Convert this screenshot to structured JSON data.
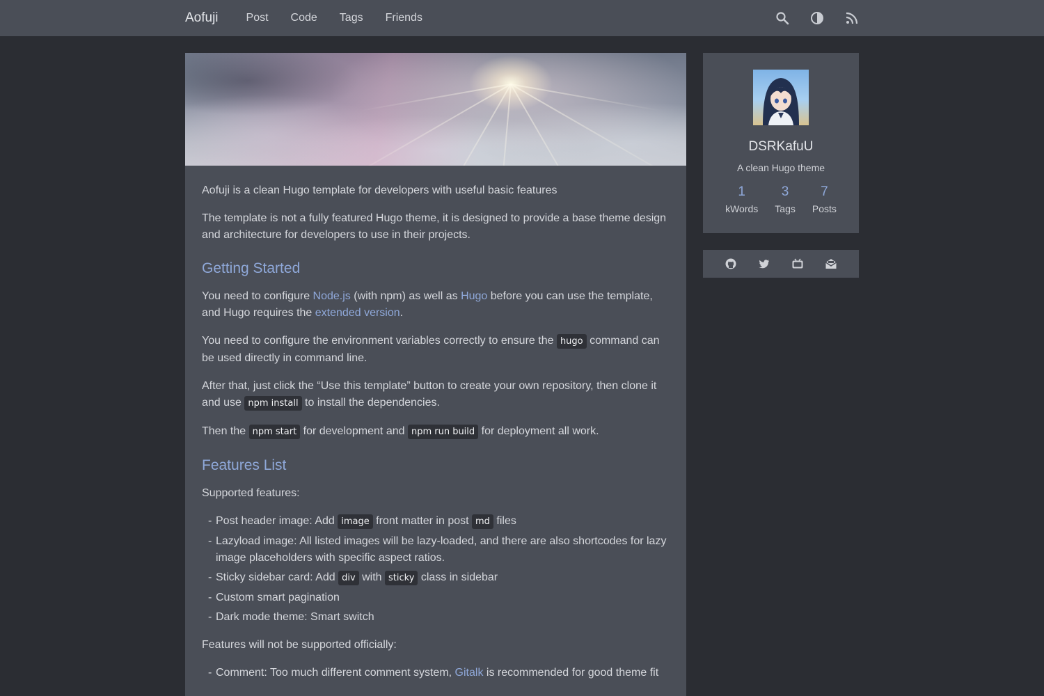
{
  "nav": {
    "brand": "Aofuji",
    "links": [
      "Post",
      "Code",
      "Tags",
      "Friends"
    ],
    "icons": [
      "search-icon",
      "theme-toggle-icon",
      "rss-icon"
    ]
  },
  "article": {
    "intro": "Aofuji is a clean Hugo template for developers with useful basic features",
    "p2": "The template is not a fully featured Hugo theme, it is designed to provide a base theme design and architecture for developers to use in their projects.",
    "h_getting_started": "Getting Started",
    "gs1": {
      "t1": "You need to configure ",
      "link1": "Node.js",
      "t2": " (with npm) as well as ",
      "link2": "Hugo",
      "t3": " before you can use the template, and Hugo requires the ",
      "link3": "extended version",
      "t4": "."
    },
    "gs2": {
      "t1": "You need to configure the environment variables correctly to ensure the ",
      "code1": "hugo",
      "t2": " command can be used directly in command line."
    },
    "gs3": {
      "t1": "After that, just click the “Use this template” button to create your own repository, then clone it and use ",
      "code1": "npm install",
      "t2": " to install the dependencies."
    },
    "gs4": {
      "t1": "Then the ",
      "code1": "npm start",
      "t2": " for development and ",
      "code2": "npm run build",
      "t3": " for deployment all work."
    },
    "h_features": "Features List",
    "supported_label": "Supported features:",
    "f1": {
      "t1": "Post header image: Add ",
      "code1": "image",
      "t2": " front matter in post ",
      "code2": "md",
      "t3": " files"
    },
    "f2": "Lazyload image: All listed images will be lazy-loaded, and there are also shortcodes for lazy image placeholders with specific aspect ratios.",
    "f3": {
      "t1": "Sticky sidebar card: Add ",
      "code1": "div",
      "t2": " with ",
      "code2": "sticky",
      "t3": " class in sidebar"
    },
    "f4": "Custom smart pagination",
    "f5": "Dark mode theme: Smart switch",
    "unsupported_label": "Features will not be supported officially:",
    "u1": {
      "t1": "Comment: Too much different comment system, ",
      "link1": "Gitalk",
      "t2": " is recommended for good theme fit"
    }
  },
  "profile": {
    "name": "DSRKafuU",
    "tagline": "A clean Hugo theme",
    "stats": [
      {
        "value": "1",
        "label": "kWords"
      },
      {
        "value": "3",
        "label": "Tags"
      },
      {
        "value": "7",
        "label": "Posts"
      }
    ]
  },
  "social": {
    "icons": [
      "github-icon",
      "twitter-icon",
      "bilibili-tv-icon",
      "email-icon"
    ]
  },
  "colors": {
    "background": "#2b2d33",
    "card": "#4a4e57",
    "accent": "#8fa8d9",
    "text": "#d5d7dc",
    "code_bg": "#2f3137"
  }
}
